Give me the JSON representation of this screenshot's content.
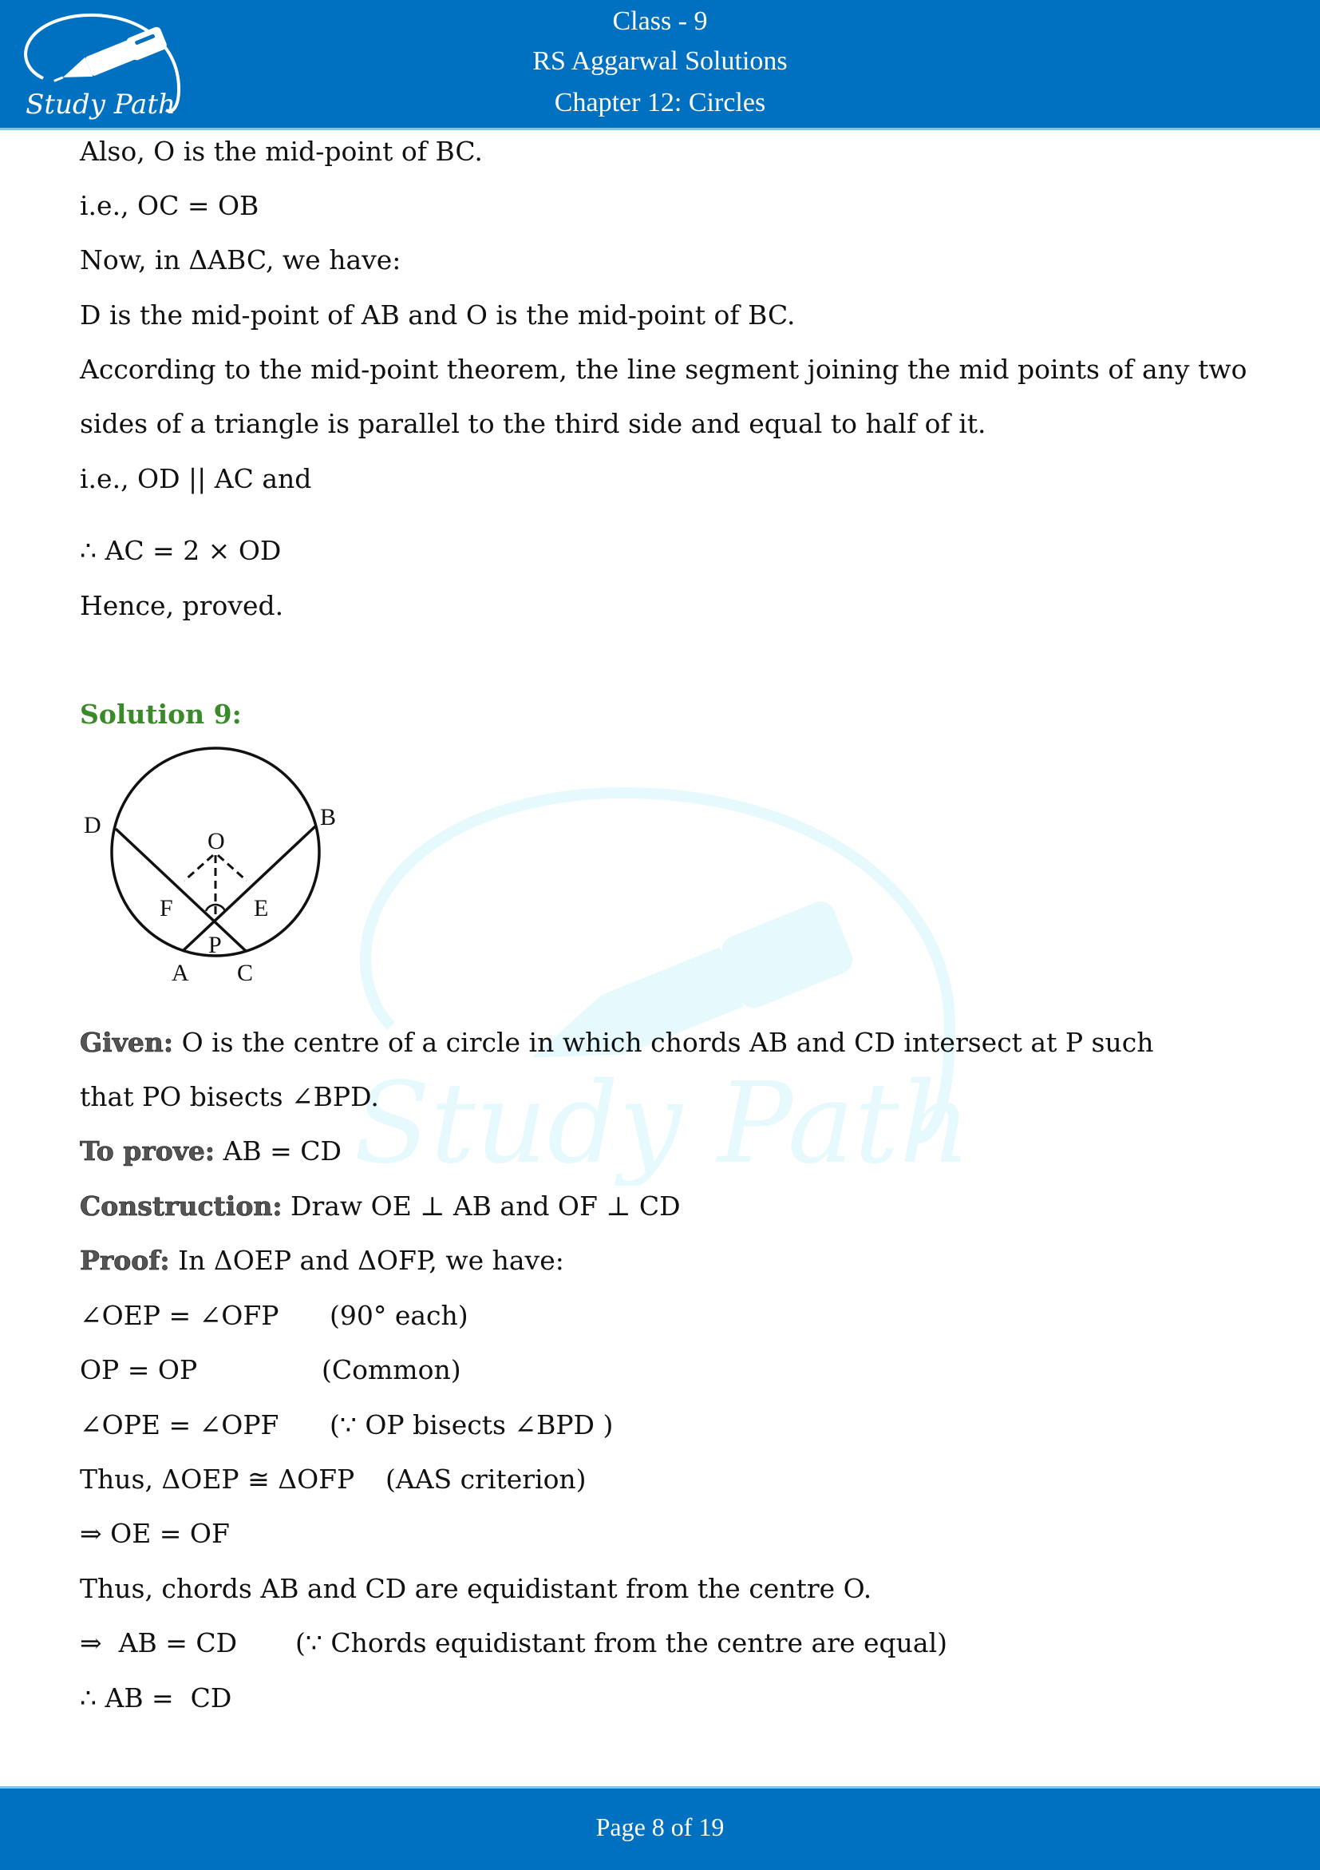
{
  "header": {
    "logo_text": "Study Path",
    "class_label": "Class - 9",
    "book_label": "RS Aggarwal Solutions",
    "chapter_label": "Chapter 12: Circles"
  },
  "prev_solution": {
    "lines": [
      "Also, O is the mid-point of BC.",
      "i.e., OC = OB",
      "Now, in ΔABC, we have:",
      "D is the mid-point of AB and O is the mid-point of BC.",
      "According to the mid-point theorem, the line segment joining the mid points of any two",
      "sides of a triangle is parallel to the third side and equal to half of it.",
      "i.e., OD || AC and",
      "∴ AC = 2 × OD",
      "Hence, proved."
    ]
  },
  "solution9": {
    "heading": "Solution 9:",
    "diagram": {
      "labels": {
        "A": "A",
        "B": "B",
        "C": "C",
        "D": "D",
        "E": "E",
        "F": "F",
        "O": "O",
        "P": "P"
      }
    },
    "given_label": "Given:",
    "given_text": " O is the centre of a circle in which chords AB and CD intersect at P such",
    "given_text2": "that PO bisects ∠BPD.",
    "to_prove_label": "To prove:",
    "to_prove_text": " AB = CD",
    "construction_label": "Construction:",
    "construction_text": " Draw OE ⊥ AB and OF ⊥ CD",
    "proof_label": "Proof:",
    "proof_text": " In ΔOEP and ΔOFP, we have:",
    "steps": [
      {
        "stmt": "∠OEP = ∠OFP",
        "reason": "(90° each)"
      },
      {
        "stmt": "OP = OP",
        "reason": "(Common)"
      },
      {
        "stmt": "∠OPE = ∠OPF",
        "reason": "(∵ OP bisects ∠BPD )"
      },
      {
        "stmt": "Thus, ΔOEP ≅ ΔOFP",
        "reason": "(AAS criterion)"
      }
    ],
    "conclusion_lines": [
      "⇒ OE = OF",
      "Thus, chords AB and CD are equidistant from the centre O."
    ],
    "final_step": {
      "stmt": "⇒  AB = CD",
      "reason": "(∵ Chords equidistant from the centre are equal)"
    },
    "final_line": "∴ AB =  CD"
  },
  "footer": {
    "page_prefix": "Page ",
    "page_current": "8",
    "page_mid": " of ",
    "page_total": "19"
  },
  "colors": {
    "brand_blue": "#0070c0",
    "solution_green": "#3a8a2a",
    "watermark": "#e6f9fd"
  }
}
